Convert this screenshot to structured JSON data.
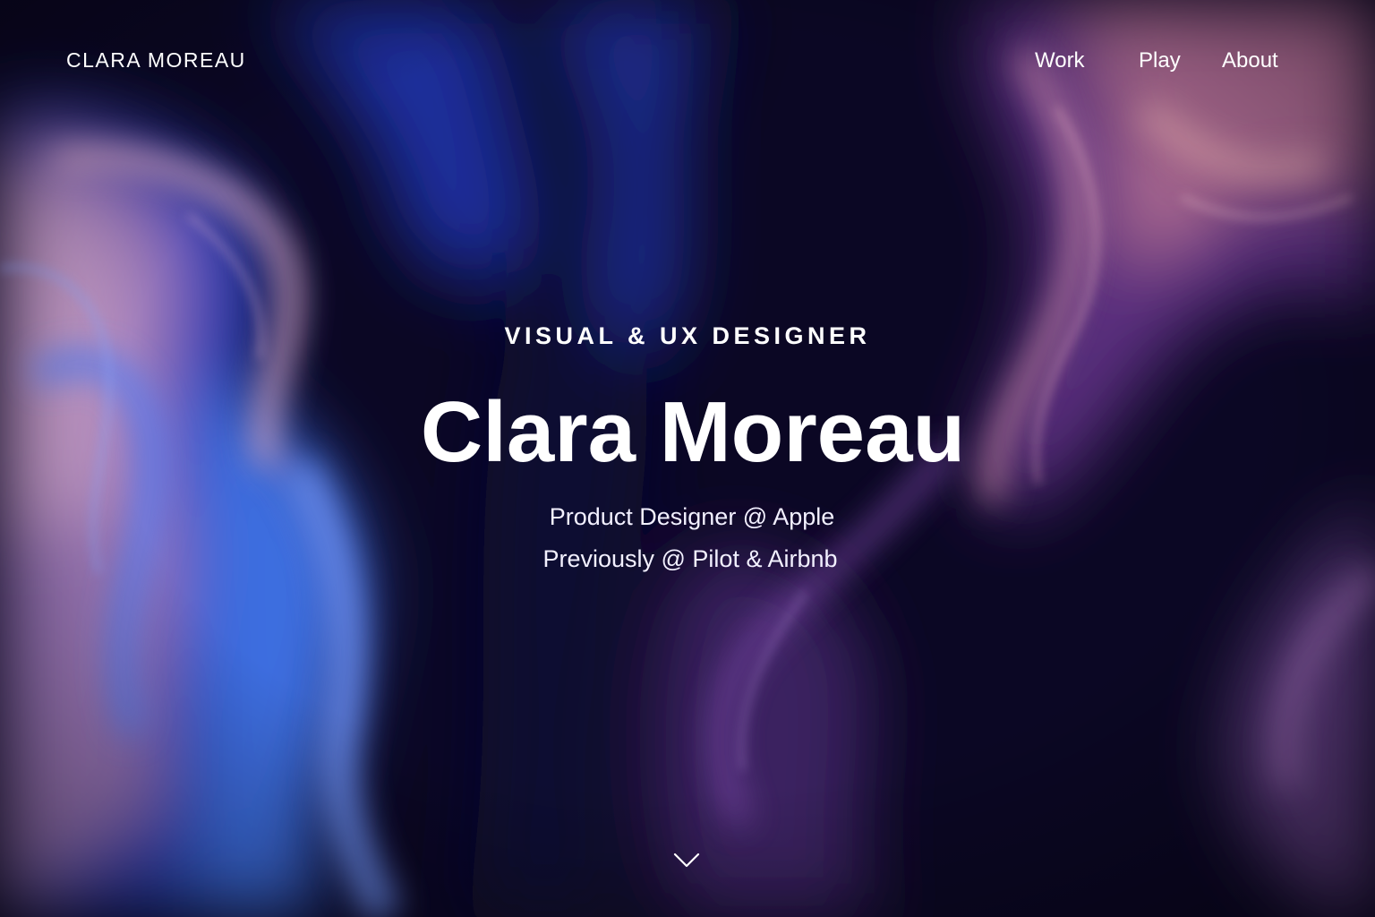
{
  "header": {
    "brand": "CLARA MOREAU",
    "nav": [
      {
        "label": "Work"
      },
      {
        "label": "Play"
      },
      {
        "label": "About"
      }
    ]
  },
  "hero": {
    "eyebrow": "VISUAL & UX DESIGNER",
    "title": "Clara Moreau",
    "lines": [
      "Product Designer @ Apple",
      "Previously @ Pilot & Airbnb"
    ]
  },
  "icons": {
    "scroll": "chevron-down-icon"
  },
  "colors": {
    "text": "#ffffff",
    "background_dark": "#0a0720",
    "blue": "#2f4fd6",
    "violet": "#6b3fa0",
    "mauve": "#b7739e"
  }
}
